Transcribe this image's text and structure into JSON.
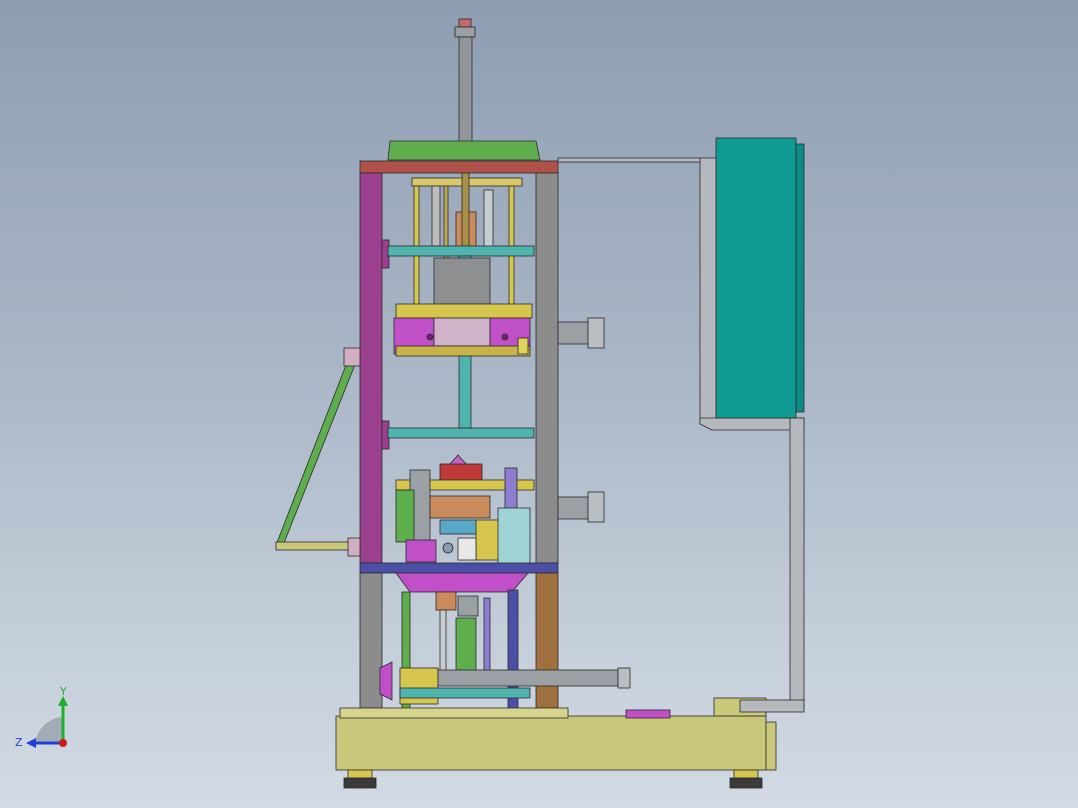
{
  "viewport": {
    "background_top": "#8e9eb2",
    "background_bottom": "#d2dae3",
    "model_description_hidden": true
  },
  "triad": {
    "y_label": "Y",
    "z_label": "Z",
    "y_color": "#1db02a",
    "z_color": "#1f3fd6",
    "x_color": "#d01919"
  },
  "colors": {
    "frame_purple": "#9b3f8f",
    "frame_gray": "#8c8c8c",
    "cabinet_teal": "#0f9b94",
    "base_olive": "#c9c77a",
    "top_green": "#5fae4e",
    "bar_teal": "#4fb3ae",
    "cross_red": "#b0524a",
    "cylinder_gray": "#9aa0a4",
    "block_magenta": "#c04fc8",
    "block_yellow": "#d7c64e",
    "brown": "#a0703f",
    "navy": "#4b4fa8"
  }
}
